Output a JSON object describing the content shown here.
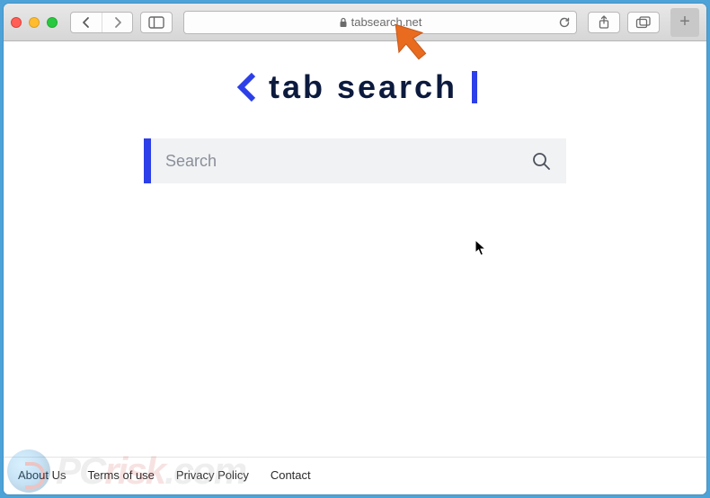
{
  "browser": {
    "url_display": "tabsearch.net",
    "back_enabled": true,
    "forward_enabled": false
  },
  "page": {
    "logo_text": "tab search",
    "search_placeholder": "Search",
    "search_value": ""
  },
  "footer": {
    "links": [
      "About Us",
      "Terms of use",
      "Privacy Policy",
      "Contact"
    ]
  },
  "watermark": {
    "text_pc": "PC",
    "text_risk": "risk",
    "text_domain": ".com"
  }
}
